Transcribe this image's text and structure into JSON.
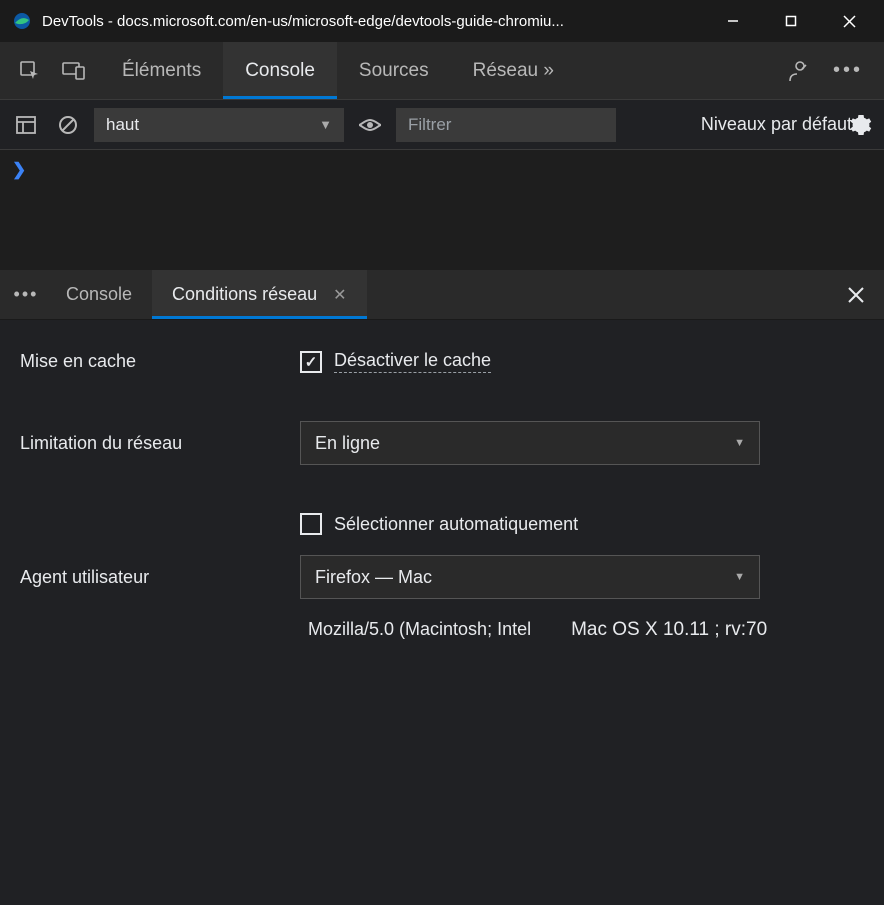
{
  "window": {
    "title": "DevTools - docs.microsoft.com/en-us/microsoft-edge/devtools-guide-chromiu..."
  },
  "main_tabs": {
    "elements": "Éléments",
    "console": "Console",
    "sources": "Sources",
    "network": "Réseau »"
  },
  "console_bar": {
    "context": "haut",
    "filter_placeholder": "Filtrer",
    "levels": "Niveaux par défaut"
  },
  "console": {
    "prompt": "❯"
  },
  "drawer": {
    "tabs": {
      "console": "Console",
      "network_conditions": "Conditions réseau"
    }
  },
  "network_conditions": {
    "caching_label": "Mise en cache",
    "disable_cache": "Désactiver le cache",
    "throttling_label": "Limitation du réseau",
    "throttling_value": "En ligne",
    "user_agent_label": "Agent utilisateur",
    "auto_select": "Sélectionner automatiquement",
    "ua_preset": "Firefox — Mac",
    "ua_string_1": "Mozilla/5.0 (Macintosh; Intel",
    "ua_string_2": "Mac OS X 10.11 ; rv:70"
  }
}
